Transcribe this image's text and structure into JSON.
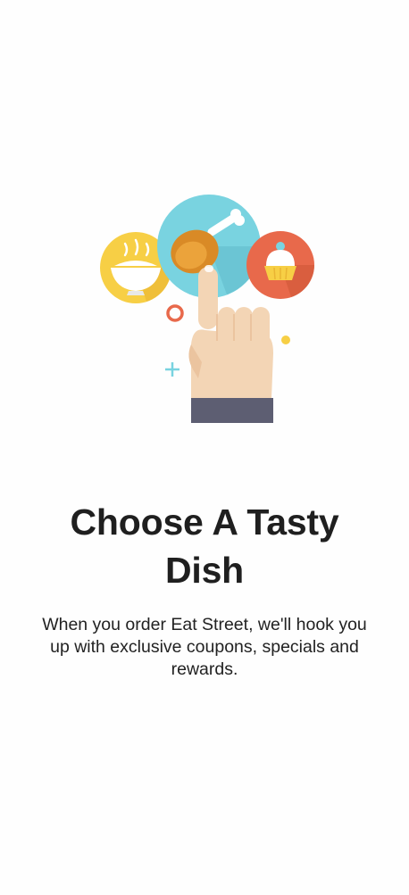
{
  "onboarding": {
    "title": "Choose A Tasty Dish",
    "description": "When you order Eat Street, we'll hook you up with exclusive coupons, specials and rewards.",
    "illustration_icons": [
      "rice-bowl-icon",
      "chicken-leg-icon",
      "cupcake-icon",
      "pointing-hand-icon"
    ]
  },
  "colors": {
    "background": "#ffffff",
    "title_text": "#1f1f1f",
    "body_text": "#222222",
    "bowl_circle": "#f7cf45",
    "chicken_circle": "#79d3e0",
    "cupcake_circle": "#e8694b",
    "hand": "#f3d5b5",
    "sleeve": "#5d5e72"
  }
}
